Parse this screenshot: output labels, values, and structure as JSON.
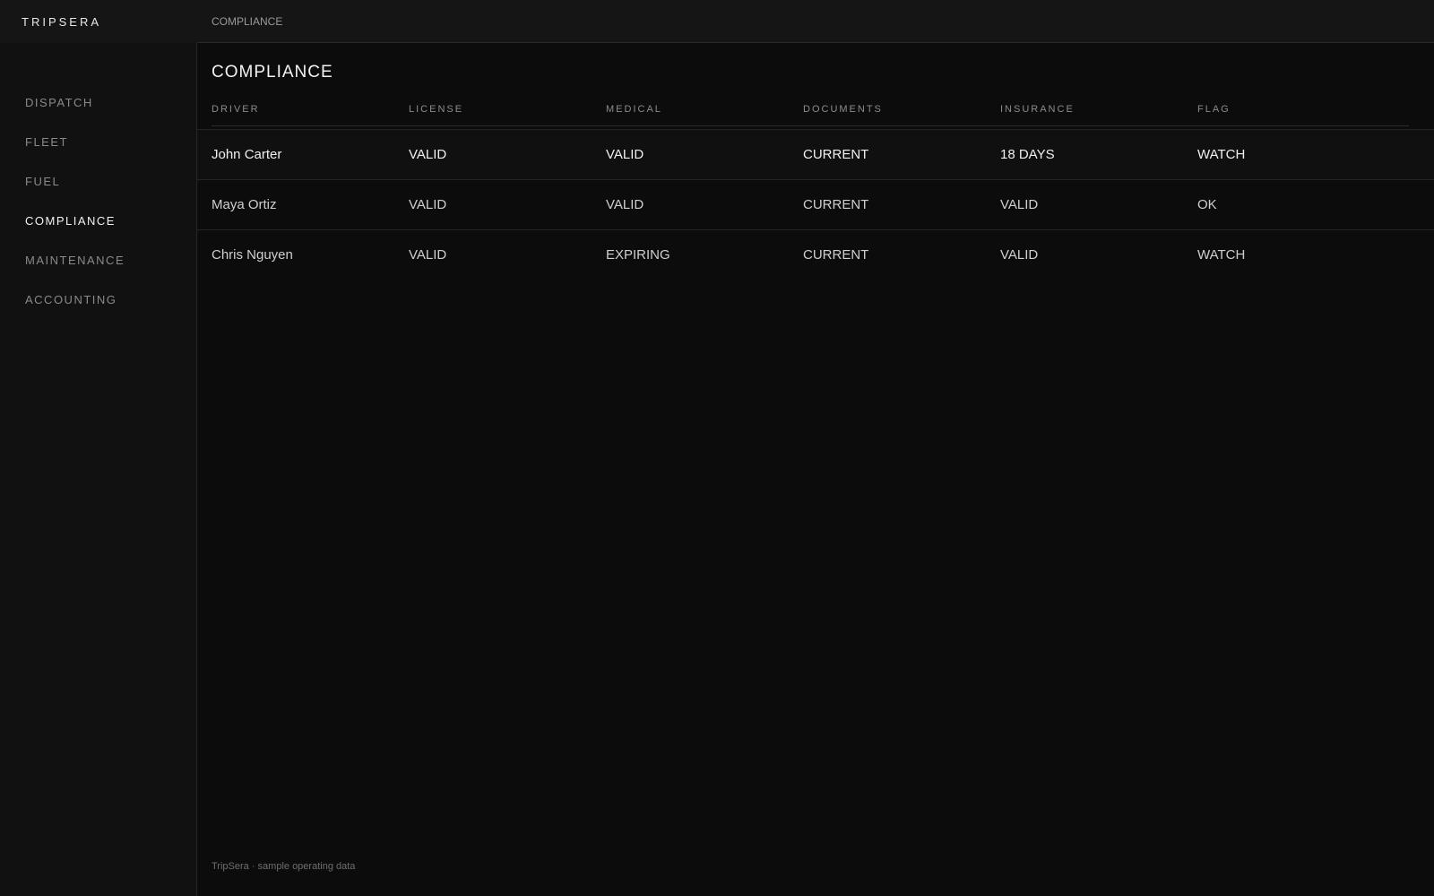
{
  "app": {
    "brand": "TRIPSERA"
  },
  "topbar": {
    "breadcrumb": "COMPLIANCE"
  },
  "sidebar": {
    "items": [
      {
        "label": "DISPATCH",
        "active": false
      },
      {
        "label": "FLEET",
        "active": false
      },
      {
        "label": "FUEL",
        "active": false
      },
      {
        "label": "COMPLIANCE",
        "active": true
      },
      {
        "label": "MAINTENANCE",
        "active": false
      },
      {
        "label": "ACCOUNTING",
        "active": false
      }
    ]
  },
  "main": {
    "title": "COMPLIANCE",
    "table": {
      "columns": [
        "DRIVER",
        "LICENSE",
        "MEDICAL",
        "DOCUMENTS",
        "INSURANCE",
        "FLAG"
      ],
      "rows": [
        [
          "John Carter",
          "VALID",
          "VALID",
          "CURRENT",
          "18 DAYS",
          "WATCH"
        ],
        [
          "Maya Ortiz",
          "VALID",
          "VALID",
          "CURRENT",
          "VALID",
          "OK"
        ],
        [
          "Chris Nguyen",
          "VALID",
          "EXPIRING",
          "CURRENT",
          "VALID",
          "WATCH"
        ]
      ]
    }
  },
  "footer": {
    "note": "TripSera · sample operating data"
  }
}
